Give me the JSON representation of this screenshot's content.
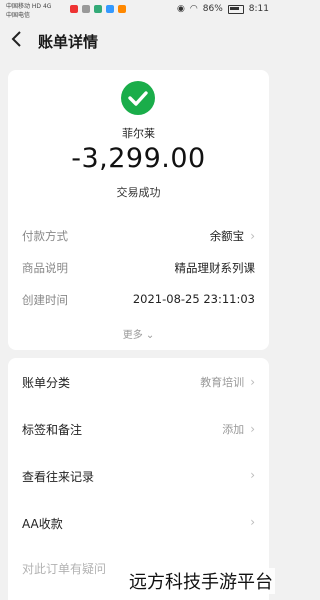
{
  "status_bar": {
    "carrier_line1": "中国移动 HD 4G",
    "carrier_line2": "中国电信",
    "battery": "86%",
    "time": "8:11"
  },
  "nav": {
    "back_icon": "←",
    "title": "账单详情"
  },
  "summary": {
    "merchant": "菲尔莱",
    "amount": "-3,299.00",
    "status": "交易成功",
    "check_color": "#1aad4a"
  },
  "details": [
    {
      "label": "付款方式",
      "value": "余额宝",
      "chevron": true
    },
    {
      "label": "商品说明",
      "value": "精品理财系列课",
      "chevron": false
    },
    {
      "label": "创建时间",
      "value": "2021-08-25 23:11:03",
      "chevron": false
    }
  ],
  "more_label": "更多",
  "list": [
    {
      "label": "账单分类",
      "right": "教育培训"
    },
    {
      "label": "标签和备注",
      "right": "添加"
    },
    {
      "label": "查看往来记录",
      "right": ""
    },
    {
      "label": "AA收款",
      "right": ""
    },
    {
      "label": "对此订单有疑问",
      "right": ""
    }
  ],
  "watermark": "远方科技手游平台"
}
